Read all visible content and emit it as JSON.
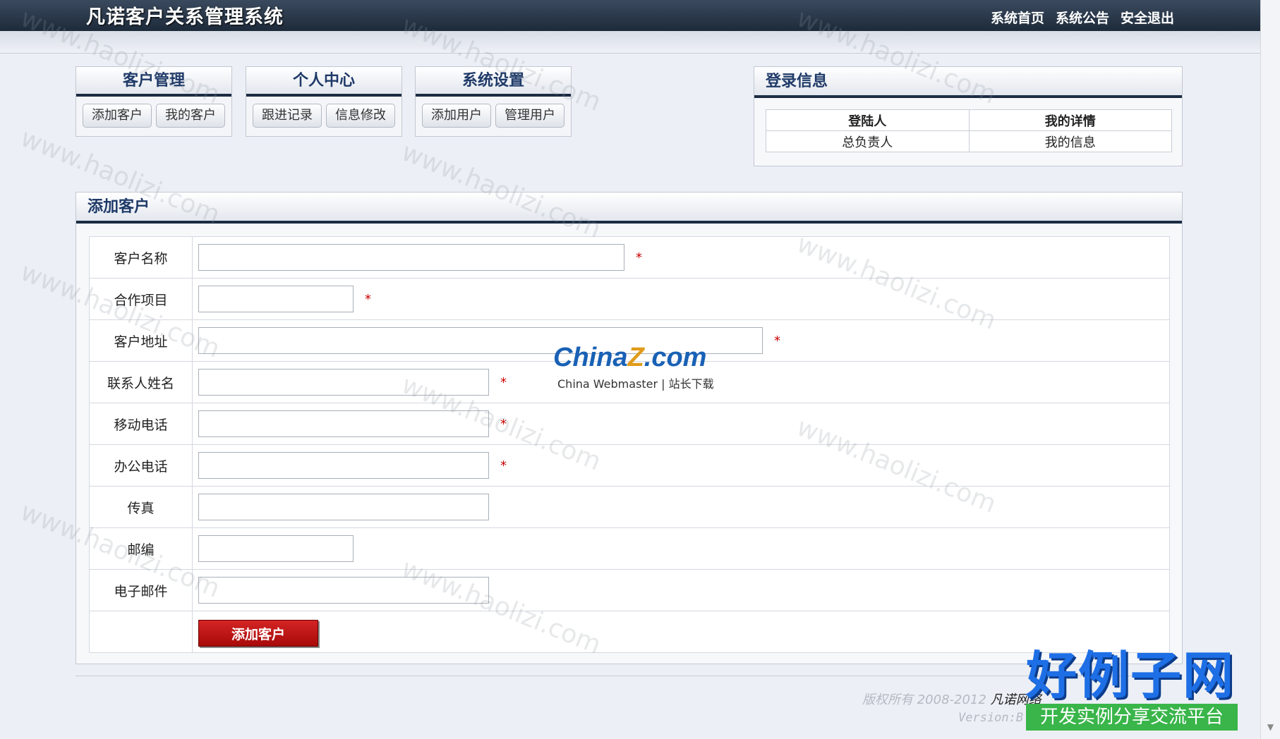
{
  "header": {
    "title": "凡诺客户关系管理系统",
    "links": [
      "系统首页",
      "系统公告",
      "安全退出"
    ]
  },
  "nav": [
    {
      "title": "客户管理",
      "buttons": [
        "添加客户",
        "我的客户"
      ]
    },
    {
      "title": "个人中心",
      "buttons": [
        "跟进记录",
        "信息修改"
      ]
    },
    {
      "title": "系统设置",
      "buttons": [
        "添加用户",
        "管理用户"
      ]
    }
  ],
  "login_info": {
    "title": "登录信息",
    "headers": [
      "登陆人",
      "我的详情"
    ],
    "values": [
      "总负责人",
      "我的信息"
    ]
  },
  "form": {
    "title": "添加客户",
    "fields": [
      {
        "label": "客户名称",
        "value": "",
        "required": true
      },
      {
        "label": "合作项目",
        "value": "",
        "required": true
      },
      {
        "label": "客户地址",
        "value": "",
        "required": true
      },
      {
        "label": "联系人姓名",
        "value": "",
        "required": true
      },
      {
        "label": "移动电话",
        "value": "",
        "required": true
      },
      {
        "label": "办公电话",
        "value": "",
        "required": true
      },
      {
        "label": "传真",
        "value": "",
        "required": false
      },
      {
        "label": "邮编",
        "value": "",
        "required": false
      },
      {
        "label": "电子邮件",
        "value": "",
        "required": false
      }
    ],
    "required_mark": "*",
    "submit_label": "添加客户"
  },
  "footer": {
    "copyright": "版权所有 2008-2012",
    "brand": "凡诺网络",
    "version": "Version:B"
  },
  "overlays": {
    "chinaz_logo": "China",
    "chinaz_logo_z": "Z",
    "chinaz_logo_tail": ".com",
    "chinaz_sub": "China Webmaster | 站长下载",
    "haolizi_title": "好例子网",
    "haolizi_sub": "开发实例分享交流平台",
    "watermark_text": "www.haolizi.com"
  },
  "colors": {
    "header_bg": "#1d2a3a",
    "panel_title": "#1f3a68",
    "required": "#cc0000",
    "submit_bg": "#c41414"
  }
}
